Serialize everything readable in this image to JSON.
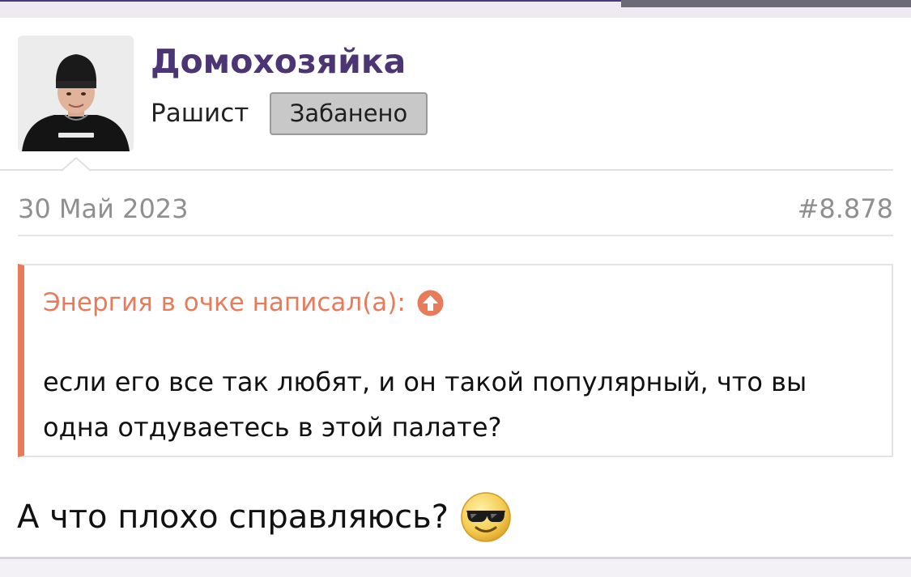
{
  "post": {
    "author": {
      "name": "Домохозяйка",
      "title": "Рашист",
      "badge": "Забанено"
    },
    "date": "30 Май 2023",
    "number": "#8.878",
    "quote": {
      "attribution": "Энергия в очке написал(а):",
      "text": "если его все так любят, и он такой популярный, что вы одна отдуваетесь в этой палате?"
    },
    "message": "А что плохо справляюсь?",
    "emoji": "cool-sunglasses-emoji"
  },
  "colors": {
    "username": "#4b3574",
    "quote_accent": "#e87b5a",
    "badge_bg": "#c8c8c8",
    "meta_text": "#8f8f8f"
  }
}
